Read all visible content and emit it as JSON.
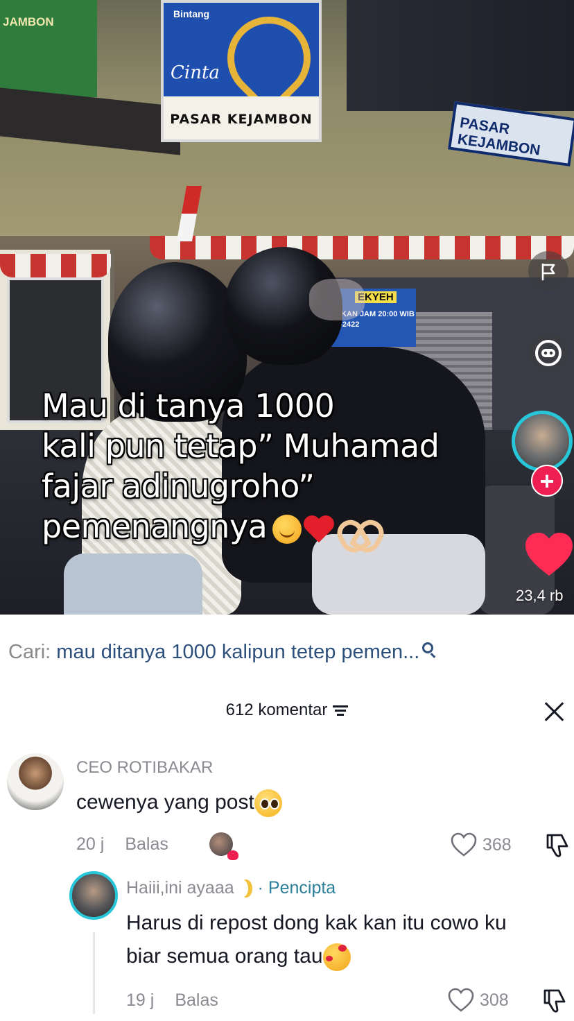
{
  "video": {
    "caption_lines": [
      "Mau di tanya 1000",
      "kali pun tetap” Muhamad",
      "fajar adinugroho”",
      "pemenangnya"
    ],
    "caption_emojis": [
      "smiling-blush-emoji",
      "red-heart-emoji",
      "heart-hands-emoji"
    ],
    "scene_text": {
      "billboard_brand": "Bintang",
      "billboard_cinta": "Cinta",
      "billboard_place": "PASAR KEJAMBON",
      "sign_left": "JAMBON",
      "sign_right": "PASAR KEJAMBON",
      "shop_sign_name": "EKYEH",
      "shop_sign_line1": "TEKAN JAM 20:00 WIB",
      "shop_sign_line2": "76-2422"
    },
    "like_count": "23,4 rb",
    "icons": {
      "report": "flag-icon",
      "bot": "robot-face-icon",
      "follow": "plus-icon",
      "like": "heart-icon"
    },
    "colors": {
      "like": "#fe2c55",
      "follow": "#ee1d52",
      "avatar_ring": "#27c6d8"
    }
  },
  "search": {
    "prefix": "Cari:",
    "query": "mau ditanya 1000 kalipun tetep pemen...",
    "icon": "search-icon"
  },
  "comments_header": {
    "count_label": "612 komentar",
    "filter_icon": "filter-icon",
    "close_icon": "close-icon"
  },
  "comments": [
    {
      "username": "CEO ROTIBAKAR",
      "text": "cewenya yang post",
      "emoji": "pleading-face-emoji",
      "time": "20 j",
      "reply_label": "Balas",
      "likes": "368",
      "liked_by_creator": true
    }
  ],
  "replies": [
    {
      "username": "Haiii,ini ayaaa",
      "badge": "· Pencipta",
      "text_line1": "Harus di repost dong kak kan itu cowo ku",
      "text_line2": "biar semua orang tau",
      "emoji": "smiling-face-with-hearts-emoji",
      "time": "19 j",
      "reply_label": "Balas",
      "likes": "308"
    }
  ],
  "colors": {
    "text_primary": "#161823",
    "text_secondary": "#8a8b91",
    "search_query": "#2c4f7c",
    "creator_badge": "#2b7f9a"
  }
}
